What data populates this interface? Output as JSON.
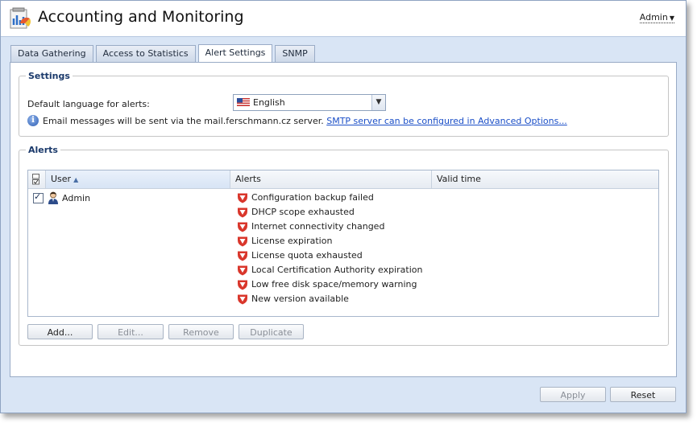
{
  "window": {
    "title": "Accounting and Monitoring",
    "user_menu": "Admin"
  },
  "tabs": [
    {
      "label": "Data Gathering",
      "active": false
    },
    {
      "label": "Access to Statistics",
      "active": false
    },
    {
      "label": "Alert Settings",
      "active": true
    },
    {
      "label": "SNMP",
      "active": false
    }
  ],
  "settings": {
    "legend": "Settings",
    "language_label": "Default language for alerts:",
    "language_value": "English",
    "info_text": "Email messages will be sent via the mail.ferschmann.cz server.",
    "info_link": "SMTP server can be configured in Advanced Options..."
  },
  "alerts": {
    "legend": "Alerts",
    "columns": [
      "User",
      "Alerts",
      "Valid time"
    ],
    "rows": [
      {
        "checked": true,
        "user": "Admin",
        "alerts": [
          "Configuration backup failed",
          "DHCP scope exhausted",
          "Internet connectivity changed",
          "License expiration",
          "License quota exhausted",
          "Local Certification Authority expiration",
          "Low free disk space/memory warning",
          "New version available"
        ],
        "valid_time": ""
      }
    ]
  },
  "buttons": {
    "add": "Add...",
    "edit": "Edit...",
    "remove": "Remove",
    "duplicate": "Duplicate",
    "apply": "Apply",
    "reset": "Reset"
  },
  "icons": {
    "app": "accounting-chart-icon",
    "info": "info-icon",
    "flag": "us-flag-icon",
    "user": "user-icon",
    "alert": "alert-shield-icon",
    "sort": "sort-ascending-icon",
    "dropdown": "chevron-down-icon"
  },
  "colors": {
    "accent": "#1b3a6b",
    "link": "#1a4ec7",
    "alert_icon": "#d9362b",
    "window_bg": "#d9e5f5"
  }
}
